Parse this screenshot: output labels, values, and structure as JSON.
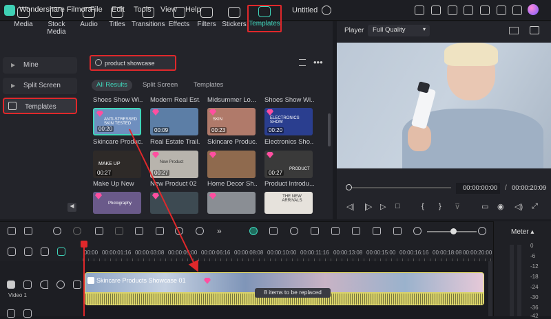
{
  "app": {
    "name": "Wondershare Filmora",
    "doc_title": "Untitled"
  },
  "menu": [
    "File",
    "Edit",
    "Tools",
    "View",
    "Help"
  ],
  "tabs": [
    "Media",
    "Stock Media",
    "Audio",
    "Titles",
    "Transitions",
    "Effects",
    "Filters",
    "Stickers",
    "Templates"
  ],
  "sidebar": {
    "items": [
      "Mine",
      "Split Screen",
      "Templates"
    ]
  },
  "search": {
    "value": "product showcase"
  },
  "filter_tabs": [
    "All Results",
    "Split Screen",
    "Templates"
  ],
  "templates": {
    "row0_captions": [
      "Shoes Show Wi...",
      "Modern Real Est...",
      "Midsummer Lo...",
      "Shoes Show Wi..."
    ],
    "row1": [
      {
        "caption": "Skincare Produc...",
        "duration": "00:20",
        "text": "ANTI-STRESSED SKIN TESTED",
        "color": "#6f8fbf"
      },
      {
        "caption": "Real Estate Trail...",
        "duration": "00:09",
        "text": "",
        "color": "#5c7ea6"
      },
      {
        "caption": "Skincare Produc...",
        "duration": "00:23",
        "text": "SKIN",
        "color": "#b07a6a"
      },
      {
        "caption": "Electronics Sho...",
        "duration": "00:20",
        "text": "ELECTRONICS SHOW",
        "color": "#2a3e8f"
      }
    ],
    "row2": [
      {
        "caption": "Make Up New",
        "duration": "00:27",
        "text": "MAKE UP",
        "color": "#2e2a28"
      },
      {
        "caption": "New Product 02",
        "duration": "00:27",
        "text": "New Product",
        "color": "#b8b4ad"
      },
      {
        "caption": "Home Decor Sh...",
        "duration": "",
        "text": "",
        "color": "#8f6a4e"
      },
      {
        "caption": "Product Introdu...",
        "duration": "00:27",
        "text": "PRODUCT",
        "color": "#3a3a3a"
      }
    ],
    "row3_texts": [
      "Photography",
      "",
      "",
      "THE NEW ARRIVALS"
    ]
  },
  "player": {
    "label": "Player",
    "quality": "Full Quality",
    "time_current": "00:00:00:00",
    "time_total": "00:00:20:09",
    "time_sep": "/"
  },
  "ruler_labels": [
    "00:00",
    "00:00:01:16",
    "00:00:03:08",
    "00:00:05:00",
    "00:00:06:16",
    "00:00:08:08",
    "00:00:10:00",
    "00:00:11:16",
    "00:00:13:08",
    "00:00:15:00",
    "00:00:16:16",
    "00:00:18:08",
    "00:00:20:00"
  ],
  "timeline": {
    "clip_title": "Skincare Products Showcase 01",
    "replace_badge": "8 items to be replaced",
    "track_label": "Video 1"
  },
  "meter": {
    "label": "Meter",
    "ticks": [
      "0",
      "-6",
      "-12",
      "-18",
      "-24",
      "-30",
      "-36",
      "-42"
    ]
  },
  "colors": {
    "accent": "#3fd6bb",
    "highlight": "#e0282b",
    "clip": "#d9d36a"
  }
}
